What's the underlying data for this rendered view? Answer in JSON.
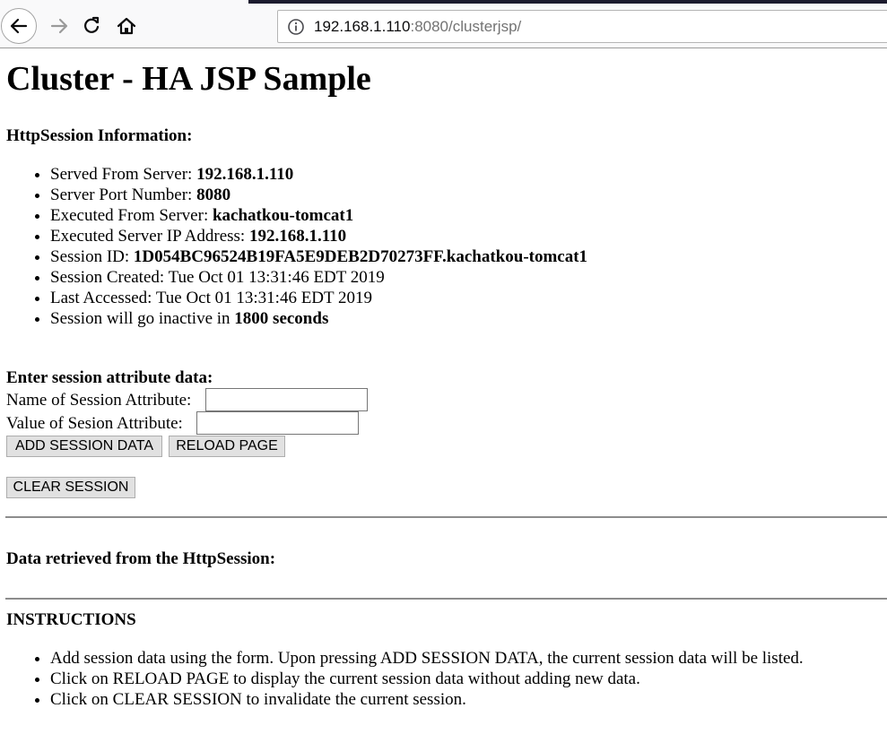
{
  "browser": {
    "url_host": "192.168.1.110",
    "url_rest": ":8080/clusterjsp/"
  },
  "page": {
    "title": "Cluster - HA JSP Sample",
    "session_heading": "HttpSession Information:",
    "session_info": [
      {
        "label": "Served From Server: ",
        "value": "192.168.1.110",
        "suffix": ""
      },
      {
        "label": "Server Port Number: ",
        "value": "8080",
        "suffix": ""
      },
      {
        "label": "Executed From Server: ",
        "value": "kachatkou-tomcat1",
        "suffix": ""
      },
      {
        "label": "Executed Server IP Address: ",
        "value": "192.168.1.110",
        "suffix": ""
      },
      {
        "label": "Session ID: ",
        "value": "1D054BC96524B19FA5E9DEB2D70273FF.kachatkou-tomcat1",
        "suffix": ""
      },
      {
        "label": "Session Created: Tue Oct 01 13:31:46 EDT 2019",
        "value": "",
        "suffix": ""
      },
      {
        "label": "Last Accessed: Tue Oct 01 13:31:46 EDT 2019",
        "value": "",
        "suffix": ""
      },
      {
        "label": "Session will go inactive in ",
        "value": "1800 seconds",
        "suffix": ""
      }
    ],
    "form": {
      "heading": "Enter session attribute data:",
      "name_label": "Name of Session Attribute:",
      "name_value": "",
      "value_label": "Value of Sesion Attribute:",
      "value_value": "",
      "add_button": "ADD SESSION DATA",
      "reload_button": "RELOAD PAGE",
      "clear_button": "CLEAR SESSION"
    },
    "retrieved_heading": "Data retrieved from the HttpSession:",
    "instructions_heading": "INSTRUCTIONS",
    "instructions": [
      "Add session data using the form. Upon pressing ADD SESSION DATA, the current session data will be listed.",
      "Click on RELOAD PAGE to display the current session data without adding new data.",
      "Click on CLEAR SESSION to invalidate the current session."
    ]
  }
}
